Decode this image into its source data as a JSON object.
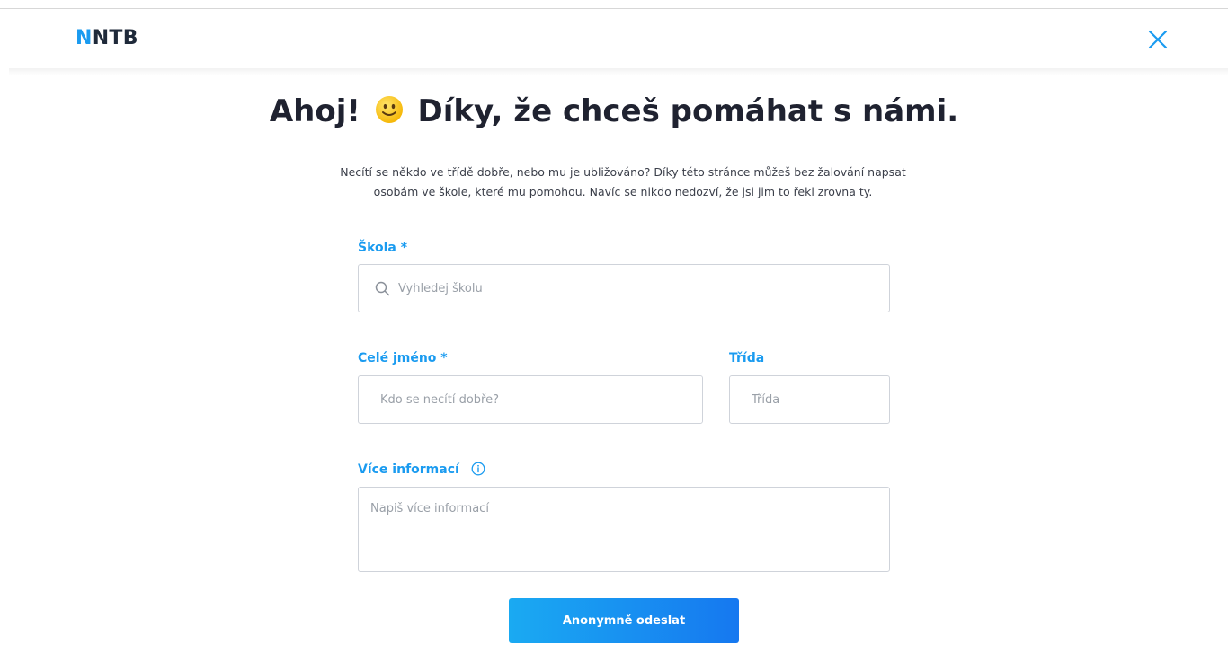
{
  "header": {
    "logo_first_letter": "N",
    "logo_rest": "NTB",
    "close_icon": "close-icon"
  },
  "hero": {
    "title_before": "Ahoj!",
    "title_after": "Díky, že chceš pomáhat s námi.",
    "emoji": "slightly-smiling-face",
    "intro_line1": "Necítí se někdo ve třídě dobře, nebo mu je ubližováno? Díky této stránce můžeš bez žalování napsat",
    "intro_line2": "osobám ve škole, které mu pomohou. Navíc se nikdo nedozví, že jsi jim to řekl zrovna ty."
  },
  "form": {
    "school": {
      "label": "Škola",
      "required_mark": "*",
      "placeholder": "Vyhledej školu",
      "icon": "search-icon"
    },
    "name": {
      "label": "Celé jméno",
      "required_mark": "*",
      "placeholder": "Kdo se necítí dobře?"
    },
    "class": {
      "label": "Třída",
      "placeholder": "Třída"
    },
    "info": {
      "label": "Více informací",
      "icon": "info-icon",
      "placeholder": "Napiš více informací"
    },
    "submit_label": "Anonymně odeslat"
  },
  "colors": {
    "accent": "#1a9bf0",
    "logo_dark": "#1f2a3a",
    "button_gradient_start": "#1aaaf2",
    "button_gradient_end": "#1678f0",
    "border": "#cfd3da"
  }
}
